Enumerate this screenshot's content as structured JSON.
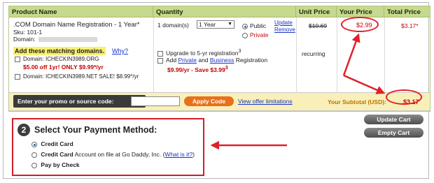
{
  "cart": {
    "headers": [
      "Product Name",
      "Quantity",
      "Unit Price",
      "Your Price",
      "Total Price"
    ],
    "product_title": ".COM Domain Name Registration - 1 Year*",
    "sku": "Sku: 101-1",
    "domain_label": "Domain:",
    "quantity_label": "1 domain(s)",
    "year_option": "1 Year",
    "privacy_public": "Public",
    "privacy_private": "Private",
    "update_link": "Update",
    "remove_link": "Remove",
    "unit_price": "$10.69",
    "your_price": "$2.99",
    "total_price": "$3.17*",
    "recurring": "recurring"
  },
  "matching": {
    "heading": "Add these matching domains.",
    "why_link": "Why?",
    "domain1": "Domain: ICHECKIN3989.ORG",
    "domain1_offer": "$5.00 off 1yr! ONLY $9.99*/yr",
    "domain2": "Domain: ICHECKIN3989.NET SALE! $8.99*/yr"
  },
  "upsell": {
    "upgrade": "Upgrade to 5-yr registration",
    "upgrade_sup": "3",
    "add_prefix": "Add",
    "private_link": "Private",
    "and_text": "and",
    "business_link": "Business",
    "registration": "Registration",
    "save": "$9.99/yr - Save $3.99",
    "save_sup": "3"
  },
  "promo": {
    "label": "Enter your promo or source code:",
    "apply_button": "Apply Code",
    "view_offer_link": "View offer limitations",
    "subtotal_label": "Your Subtotal (USD):",
    "subtotal_value": "$3.17"
  },
  "actions": {
    "update_cart": "Update Cart",
    "empty_cart": "Empty Cart"
  },
  "payment": {
    "step_number": "2",
    "title": "Select Your Payment Method:",
    "option1": "Credit Card",
    "option2_bold": "Credit Card",
    "option2_rest": "Account on file at Go Daddy, Inc.",
    "option2_link": "What is it?",
    "option3": "Pay by Check"
  },
  "colors": {
    "header_bg": "#c6d98f",
    "promo_bg": "#f8f0b8",
    "accent_red": "#c80000",
    "annotation_red": "#e0202a",
    "apply_orange": "#e8701c"
  }
}
